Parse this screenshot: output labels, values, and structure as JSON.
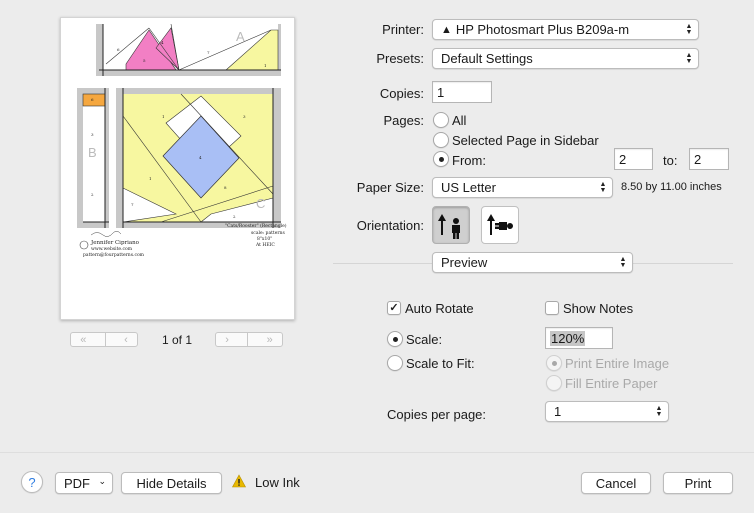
{
  "preview": {
    "page_indicator": "1 of 1",
    "block_letters": [
      "A",
      "B",
      "C"
    ],
    "piece_numbers": [
      "6",
      "5",
      "4",
      "7",
      "1",
      "6",
      "3",
      "2",
      "1",
      "3",
      "4",
      "1",
      "8",
      "7",
      "2"
    ],
    "caption_title": "\"Cats/Rooster\" (Rectangle)",
    "caption_lines": [
      "scale: patterns",
      "8\"x10\"",
      "At HEIC"
    ],
    "designer_lines": [
      "Jennifer Cipriano",
      "www.website.com",
      "pattern@fourpatterns.com"
    ]
  },
  "printer": {
    "label": "Printer:",
    "value": "HP Photosmart Plus B209a-m",
    "warning_glyph": "▲"
  },
  "presets": {
    "label": "Presets:",
    "value": "Default Settings"
  },
  "copies": {
    "label": "Copies:",
    "value": "1"
  },
  "pages": {
    "label": "Pages:",
    "all": "All",
    "selected": "Selected Page in Sidebar",
    "from": "From:",
    "from_value": "2",
    "to": "to:",
    "to_value": "2",
    "selected_option": "from"
  },
  "paper_size": {
    "label": "Paper Size:",
    "value": "US Letter",
    "dimensions": "8.50 by 11.00 inches"
  },
  "orientation": {
    "label": "Orientation:",
    "selected": "portrait"
  },
  "section_popup": {
    "value": "Preview"
  },
  "preview_options": {
    "auto_rotate": {
      "label": "Auto Rotate",
      "checked": true,
      "mark": "✓"
    },
    "show_notes": {
      "label": "Show Notes",
      "checked": false
    },
    "scale": {
      "label": "Scale:",
      "value": "120%",
      "selected": true
    },
    "scale_to_fit": {
      "label": "Scale to Fit:",
      "selected": false
    },
    "print_entire_image": {
      "label": "Print Entire Image",
      "selected": true,
      "enabled": false
    },
    "fill_entire_paper": {
      "label": "Fill Entire Paper",
      "selected": false,
      "enabled": false
    },
    "copies_per_page": {
      "label": "Copies per page:",
      "value": "1"
    }
  },
  "bottom": {
    "help": "?",
    "pdf": "PDF",
    "hide_details": "Hide Details",
    "low_ink": "Low Ink",
    "cancel": "Cancel",
    "print": "Print"
  },
  "colors": {
    "pink": "#f27fc4",
    "yellow": "#f7f7a0",
    "blue": "#a9bff5",
    "orange": "#f5a73f",
    "gray": "#c4c4c4",
    "warning": "#e8b800"
  }
}
